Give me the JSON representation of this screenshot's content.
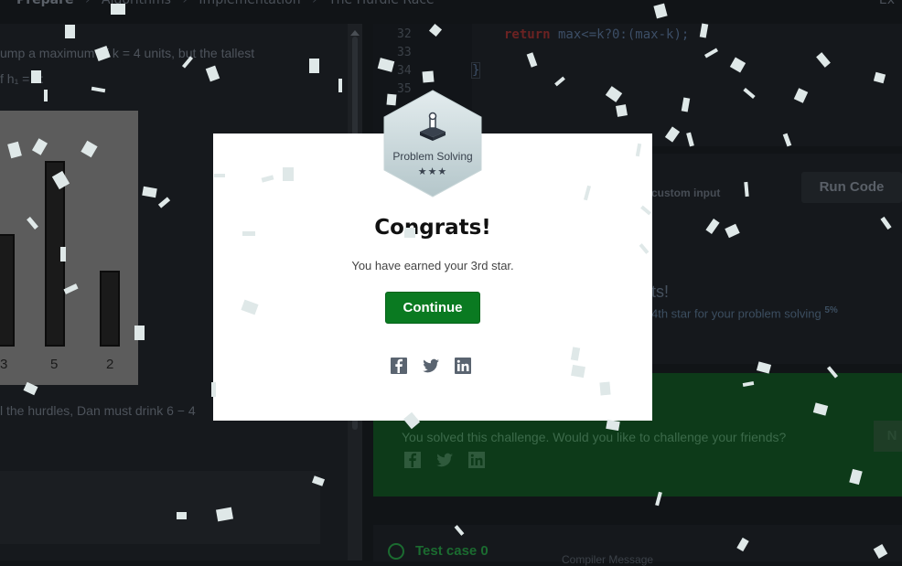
{
  "breadcrumb": {
    "items": [
      "Prepare",
      "Algorithms",
      "Implementation",
      "The Hurdle Race"
    ],
    "separator": "›",
    "exit_label": "Ex"
  },
  "problem": {
    "line1": "ump a maximum of k = 4 units, but the tallest",
    "line2": "f h₁ = 6:",
    "line3": "l the hurdles, Dan must drink 6 − 4",
    "bar_labels": [
      "3",
      "5",
      "2"
    ]
  },
  "editor": {
    "line_numbers": [
      "32",
      "33",
      "34",
      "35"
    ],
    "code_keyword": "return",
    "code_rest": " max<=k?0:(max-k);",
    "closing_brace": "}"
  },
  "run_panel": {
    "custom_input_label": "custom input",
    "run_button": "Run Code",
    "congrats_bg": "ts!",
    "next_star_text": "4th star for your problem solving",
    "next_star_pct": "5%"
  },
  "solved_box": {
    "text": "You solved this challenge. Would you like to challenge your friends?",
    "next_button": "N"
  },
  "test_case": {
    "label": "Test case 0",
    "compiler_message": "Compiler Message"
  },
  "modal": {
    "badge_label": "Problem Solving",
    "badge_stars": "★★★",
    "title": "Congrats!",
    "subtitle": "You have earned your 3rd star.",
    "continue_button": "Continue",
    "share_icons": [
      "facebook-icon",
      "twitter-icon",
      "linkedin-icon"
    ]
  },
  "colors": {
    "accent_green": "#0a7a21",
    "modal_bg": "#ffffff",
    "page_bg": "#111417"
  }
}
